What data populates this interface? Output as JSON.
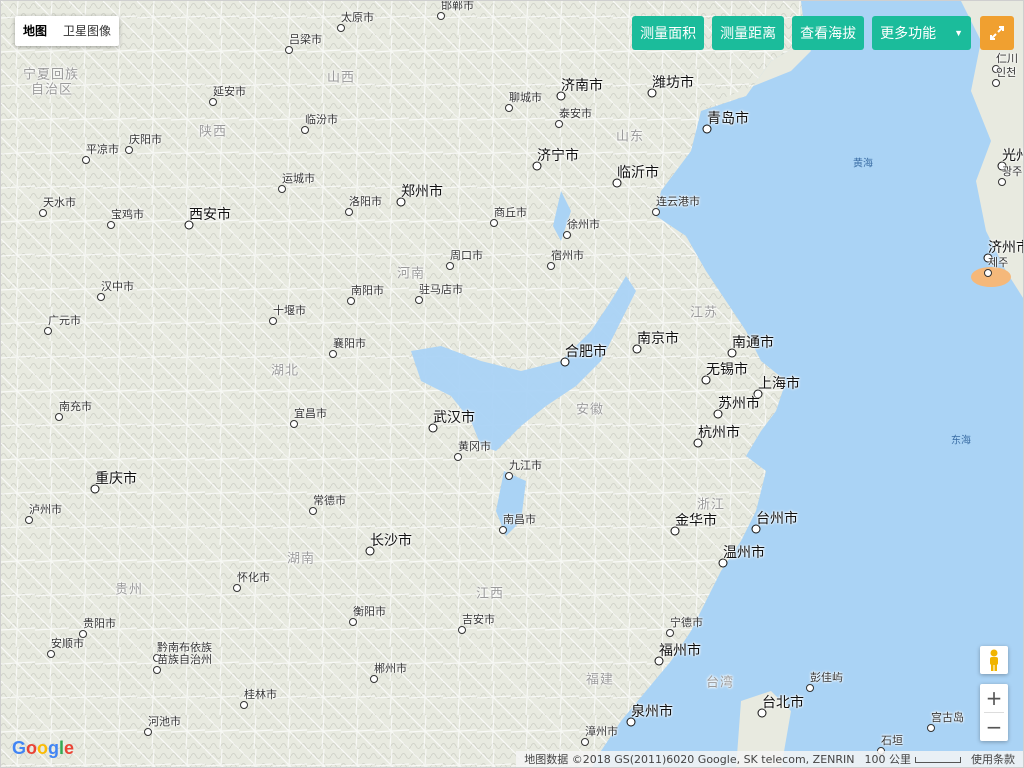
{
  "map_type": {
    "map_label": "地图",
    "satellite_label": "卫星图像"
  },
  "tools": {
    "area": "测量面积",
    "distance": "测量距离",
    "elevation": "查看海拔",
    "more": "更多功能"
  },
  "footer": {
    "attribution": "地图数据 ©2018 GS(2011)6020 Google, SK telecom, ZENRIN",
    "scale": "100 公里",
    "terms": "使用条款"
  },
  "brand": "Google",
  "colors": {
    "sea": "#aad3f5",
    "land": "#e8eae0",
    "lake": "#aad3f5",
    "button": "#1bbc9b",
    "expand": "#f0a030"
  },
  "icons": [
    "expand-icon",
    "pegman-icon",
    "zoom-in-icon",
    "zoom-out-icon",
    "caret-down-icon"
  ],
  "cities": [
    {
      "name": "太原市",
      "t": "small"
    },
    {
      "name": "吕梁市",
      "t": "small"
    },
    {
      "name": "延安市",
      "t": "small"
    },
    {
      "name": "临汾市",
      "t": "small"
    },
    {
      "name": "庆阳市",
      "t": "small"
    },
    {
      "name": "平凉市",
      "t": "small"
    },
    {
      "name": "运城市",
      "t": "small"
    },
    {
      "name": "天水市",
      "t": "small"
    },
    {
      "name": "宝鸡市",
      "t": "small"
    },
    {
      "name": "西安市",
      "t": "major"
    },
    {
      "name": "洛阳市",
      "t": "small"
    },
    {
      "name": "郑州市",
      "t": "major"
    },
    {
      "name": "济南市",
      "t": "major"
    },
    {
      "name": "聊城市",
      "t": "small"
    },
    {
      "name": "泰安市",
      "t": "small"
    },
    {
      "name": "潍坊市",
      "t": "major"
    },
    {
      "name": "青岛市",
      "t": "major"
    },
    {
      "name": "济宁市",
      "t": "major"
    },
    {
      "name": "临沂市",
      "t": "major"
    },
    {
      "name": "商丘市",
      "t": "small"
    },
    {
      "name": "徐州市",
      "t": "small"
    },
    {
      "name": "连云港市",
      "t": "small"
    },
    {
      "name": "周口市",
      "t": "small"
    },
    {
      "name": "宿州市",
      "t": "small"
    },
    {
      "name": "汉中市",
      "t": "small"
    },
    {
      "name": "广元市",
      "t": "small"
    },
    {
      "name": "十堰市",
      "t": "small"
    },
    {
      "name": "南阳市",
      "t": "small"
    },
    {
      "name": "驻马店市",
      "t": "small"
    },
    {
      "name": "襄阳市",
      "t": "small"
    },
    {
      "name": "合肥市",
      "t": "major"
    },
    {
      "name": "南京市",
      "t": "major"
    },
    {
      "name": "南通市",
      "t": "major"
    },
    {
      "name": "无锡市",
      "t": "major"
    },
    {
      "name": "上海市",
      "t": "major"
    },
    {
      "name": "苏州市",
      "t": "major"
    },
    {
      "name": "南充市",
      "t": "small"
    },
    {
      "name": "宜昌市",
      "t": "small"
    },
    {
      "name": "武汉市",
      "t": "major"
    },
    {
      "name": "黄冈市",
      "t": "small"
    },
    {
      "name": "杭州市",
      "t": "major"
    },
    {
      "name": "九江市",
      "t": "small"
    },
    {
      "name": "重庆市",
      "t": "major"
    },
    {
      "name": "泸州市",
      "t": "small"
    },
    {
      "name": "常德市",
      "t": "small"
    },
    {
      "name": "南昌市",
      "t": "small"
    },
    {
      "name": "金华市",
      "t": "major"
    },
    {
      "name": "台州市",
      "t": "major"
    },
    {
      "name": "长沙市",
      "t": "major"
    },
    {
      "name": "温州市",
      "t": "major"
    },
    {
      "name": "怀化市",
      "t": "small"
    },
    {
      "name": "衡阳市",
      "t": "small"
    },
    {
      "name": "吉安市",
      "t": "small"
    },
    {
      "name": "贵阳市",
      "t": "small"
    },
    {
      "name": "安顺市",
      "t": "small"
    },
    {
      "name": "黔南布依族",
      "t": "small"
    },
    {
      "name": "苗族自治州",
      "t": "small"
    },
    {
      "name": "宁德市",
      "t": "small"
    },
    {
      "name": "福州市",
      "t": "major"
    },
    {
      "name": "郴州市",
      "t": "small"
    },
    {
      "name": "桂林市",
      "t": "small"
    },
    {
      "name": "河池市",
      "t": "small"
    },
    {
      "name": "泉州市",
      "t": "major"
    },
    {
      "name": "漳州市",
      "t": "small"
    },
    {
      "name": "台北市",
      "t": "major"
    },
    {
      "name": "光州",
      "t": "major"
    },
    {
      "name": "광주",
      "t": "small"
    },
    {
      "name": "济州市",
      "t": "major"
    },
    {
      "name": "제주",
      "t": "small"
    },
    {
      "name": "仁川",
      "t": "small"
    },
    {
      "name": "인천",
      "t": "small"
    },
    {
      "name": "彭佳屿",
      "t": "small"
    },
    {
      "name": "宫古岛",
      "t": "small"
    },
    {
      "name": "石垣",
      "t": "small"
    },
    {
      "name": "邯郸市",
      "t": "small"
    }
  ],
  "regions": [
    "宁夏回族",
    "自治区",
    "山西",
    "陕西",
    "山东",
    "河南",
    "江苏",
    "湖北",
    "安徽",
    "浙江",
    "湖南",
    "江西",
    "贵州",
    "福建",
    "台湾"
  ],
  "seas": [
    "黄海",
    "东海"
  ]
}
